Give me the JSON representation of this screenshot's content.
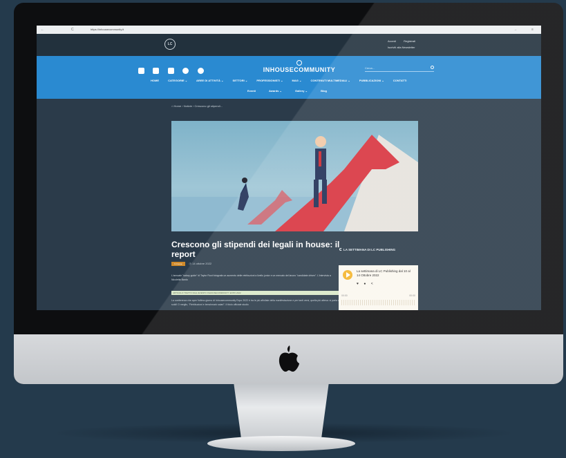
{
  "browser": {
    "url": "https://inhousecommunity.it",
    "nav_back": "←",
    "nav_forward": "→",
    "nav_reload": "C",
    "menu_glyph": "≡"
  },
  "header": {
    "logo_text": "LC",
    "top_links": [
      "Accedi",
      "Registrati",
      "Iscriviti alla Newsletter"
    ],
    "brand": "INHOUSECOMMUNITY",
    "search_placeholder": "Cerca..."
  },
  "menu_primary": [
    "HOME",
    "CATEGORIE ⌄",
    "AREE DI ATTIVITÀ ⌄",
    "SETTORI ⌄",
    "PROFESSIONISTI ⌄",
    "MAG ⌄",
    "CONTENUTI MULTIMEDIALI ⌄",
    "PUBBLICAZIONI ⌄",
    "CONTATTI"
  ],
  "menu_secondary": [
    "Eventi",
    "Awards ⌄",
    "Gallery ⌄",
    "Blog"
  ],
  "breadcrumb": "Home  ›  Notizie  ›  Crescono gli stipendi...",
  "article": {
    "title": "Crescono gli stipendi dei legali in house: il report",
    "tag": "In house",
    "date": "14 ottobre 2022",
    "excerpt": "L'annuale \"salary guide\" di Taylor Root fotografa un aumento delle retribuzioni a livello junior e un mercato del lavoro \"candidate driven\". L'intervista a Nicoletta Bardo",
    "highlight": "ARTICOLO TRATTO DALL'EVENTO INHOUSECOMMUNITY EXPO 2022",
    "body": "La conferenza che apre l'ultimo giorno di Inhousecommunity Expo 2022 è tra le più affollate della manifestazione e per tanti versi, quella più attesa: si parla di soldi! O meglio, \"Retribuzioni e benchmark salari\". Il titolo ufficiale studio"
  },
  "sidebar": {
    "section_title": "LA SETTIMANA DI LC PUBLISHING",
    "podcast_title": "La settimana di LC Publishing dal 10 al 14 Ottobre 2022",
    "time_start": "00:00",
    "time_end": "00:00"
  },
  "colors": {
    "page_bg": "#243a4c",
    "header_blue": "#2a8ad1",
    "site_dark": "#2b3b4a",
    "tag_orange": "#d08a2a",
    "play_yellow": "#f4b42a"
  }
}
